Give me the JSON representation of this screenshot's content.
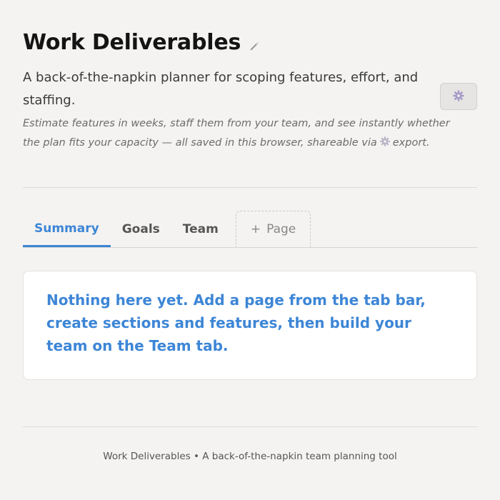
{
  "header": {
    "title": "Work Deliverables",
    "subtitle": "A back-of-the-napkin planner for scoping features, effort, and staffing.",
    "note_before": "Estimate features in weeks, staff them from your team, and see instantly whether the plan fits your capacity — all saved in this browser, shareable via",
    "note_after": "export.",
    "edit_icon": "pencil-icon",
    "settings_icon": "gear-icon"
  },
  "tabs": [
    {
      "label": "Summary",
      "active": true
    },
    {
      "label": "Goals",
      "active": false
    },
    {
      "label": "Team",
      "active": false
    }
  ],
  "add_tab": {
    "plus": "+",
    "label": "Page"
  },
  "main": {
    "empty_message": "Nothing here yet. Add a page from the tab bar, create sections and features, then build your team on the Team tab."
  },
  "footer": {
    "text": "Work Deliverables • A back-of-the-napkin team planning tool"
  },
  "colors": {
    "accent": "#3d86d6",
    "background": "#f4f3f1",
    "card": "#ffffff"
  }
}
